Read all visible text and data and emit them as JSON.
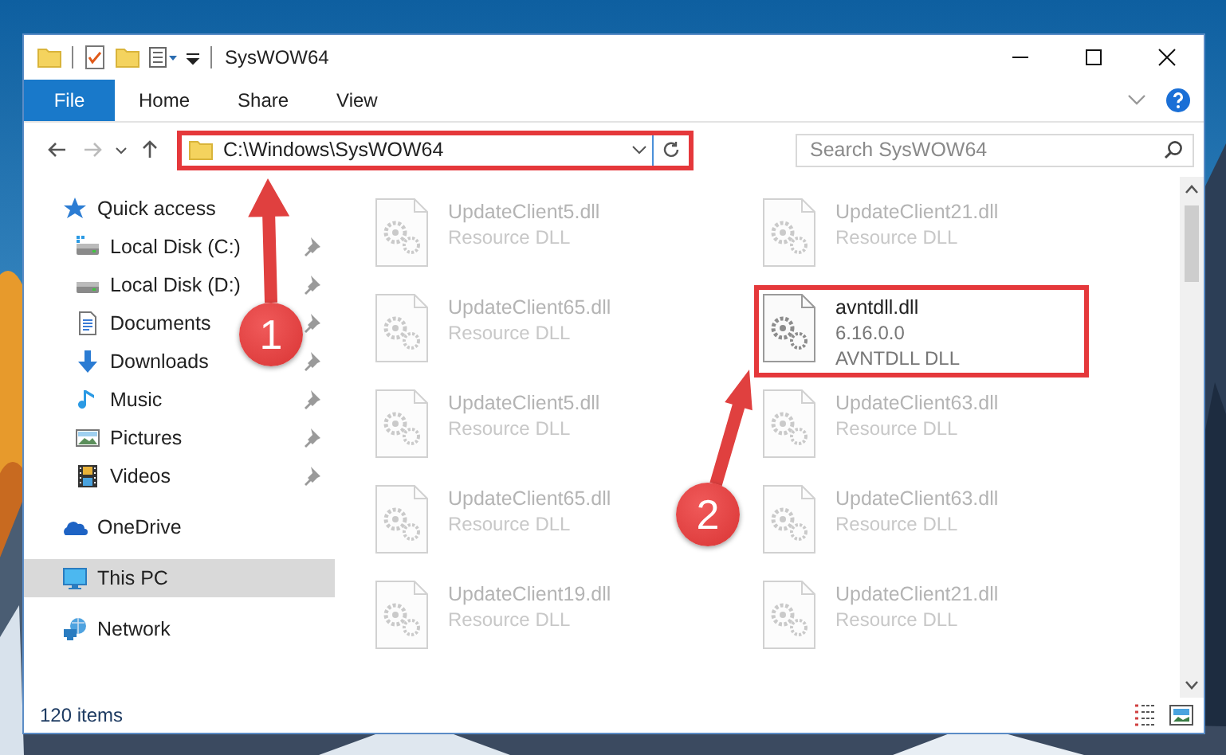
{
  "window": {
    "title": "SysWOW64"
  },
  "ribbon": {
    "tabs": [
      {
        "label": "File",
        "kind": "menu"
      },
      {
        "label": "Home",
        "kind": "tab"
      },
      {
        "label": "Share",
        "kind": "tab"
      },
      {
        "label": "View",
        "kind": "tab"
      }
    ]
  },
  "address_bar": {
    "path": "C:\\Windows\\SysWOW64",
    "highlighted": true
  },
  "search": {
    "placeholder": "Search SysWOW64"
  },
  "sidebar": {
    "items": [
      {
        "label": "Quick access",
        "selected": false,
        "children": [
          {
            "label": "Local Disk (C:)",
            "pinned": true,
            "selected": false
          },
          {
            "label": "Local Disk (D:)",
            "pinned": true,
            "selected": false
          },
          {
            "label": "Documents",
            "pinned": true,
            "selected": false
          },
          {
            "label": "Downloads",
            "pinned": true,
            "selected": false
          },
          {
            "label": "Music",
            "pinned": true,
            "selected": false
          },
          {
            "label": "Pictures",
            "pinned": true,
            "selected": false
          },
          {
            "label": "Videos",
            "pinned": true,
            "selected": false
          }
        ]
      },
      {
        "label": "OneDrive",
        "selected": false
      },
      {
        "label": "This PC",
        "selected": true
      },
      {
        "label": "Network",
        "selected": false
      }
    ]
  },
  "files": [
    {
      "name": "UpdateClient5.dll",
      "details": [
        "Resource DLL"
      ],
      "blurred": true,
      "highlighted": false
    },
    {
      "name": "UpdateClient21.dll",
      "details": [
        "Resource DLL"
      ],
      "blurred": true,
      "highlighted": false
    },
    {
      "name": "UpdateClient65.dll",
      "details": [
        "Resource DLL"
      ],
      "blurred": true,
      "highlighted": false
    },
    {
      "name": "avntdll.dll",
      "details": [
        "6.16.0.0",
        "AVNTDLL DLL"
      ],
      "blurred": false,
      "highlighted": true
    },
    {
      "name": "UpdateClient5.dll",
      "details": [
        "Resource DLL"
      ],
      "blurred": true,
      "highlighted": false
    },
    {
      "name": "UpdateClient63.dll",
      "details": [
        "Resource DLL"
      ],
      "blurred": true,
      "highlighted": false
    },
    {
      "name": "UpdateClient65.dll",
      "details": [
        "Resource DLL"
      ],
      "blurred": true,
      "highlighted": false
    },
    {
      "name": "UpdateClient63.dll",
      "details": [
        "Resource DLL"
      ],
      "blurred": true,
      "highlighted": false
    },
    {
      "name": "UpdateClient19.dll",
      "details": [
        "Resource DLL"
      ],
      "blurred": true,
      "highlighted": false
    },
    {
      "name": "UpdateClient21.dll",
      "details": [
        "Resource DLL"
      ],
      "blurred": true,
      "highlighted": false
    }
  ],
  "status_bar": {
    "item_count": "120 items"
  },
  "annotations": [
    {
      "label": "1"
    },
    {
      "label": "2"
    }
  ]
}
